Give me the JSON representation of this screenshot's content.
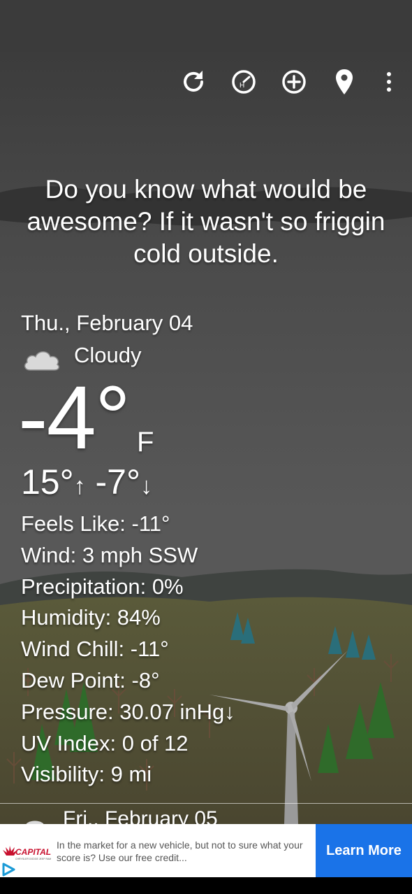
{
  "toolbar": {
    "icons": [
      "refresh-icon",
      "history-clock-icon",
      "add-location-icon",
      "location-pin-icon",
      "more-vert-icon"
    ]
  },
  "quote": "Do you know what would be awesome? If it wasn't so friggin cold outside.",
  "current": {
    "date": "Thu., February 04",
    "condition": "Cloudy",
    "condition_icon": "cloud-icon",
    "temperature": "-4°",
    "unit": "F",
    "high": "15°",
    "high_arrow": "↑",
    "low": "-7°",
    "low_arrow": "↓"
  },
  "details": [
    "Feels Like: -11°",
    "Wind: 3 mph SSW",
    "Precipitation: 0%",
    "Humidity: 84%",
    "Wind Chill: -11°",
    "Dew Point: -8°",
    "Pressure: 30.07 inHg↓",
    "UV Index: 0 of 12",
    "Visibility: 9 mi"
  ],
  "next_day": {
    "label": "Fri., February 05"
  },
  "ad": {
    "brand": "CAPITAL",
    "text": "In the market for a new vehicle, but not to sure what your score is? Use our free credit...",
    "cta": "Learn More",
    "brand_color": "#c8102e",
    "cta_color": "#1a73e8"
  }
}
